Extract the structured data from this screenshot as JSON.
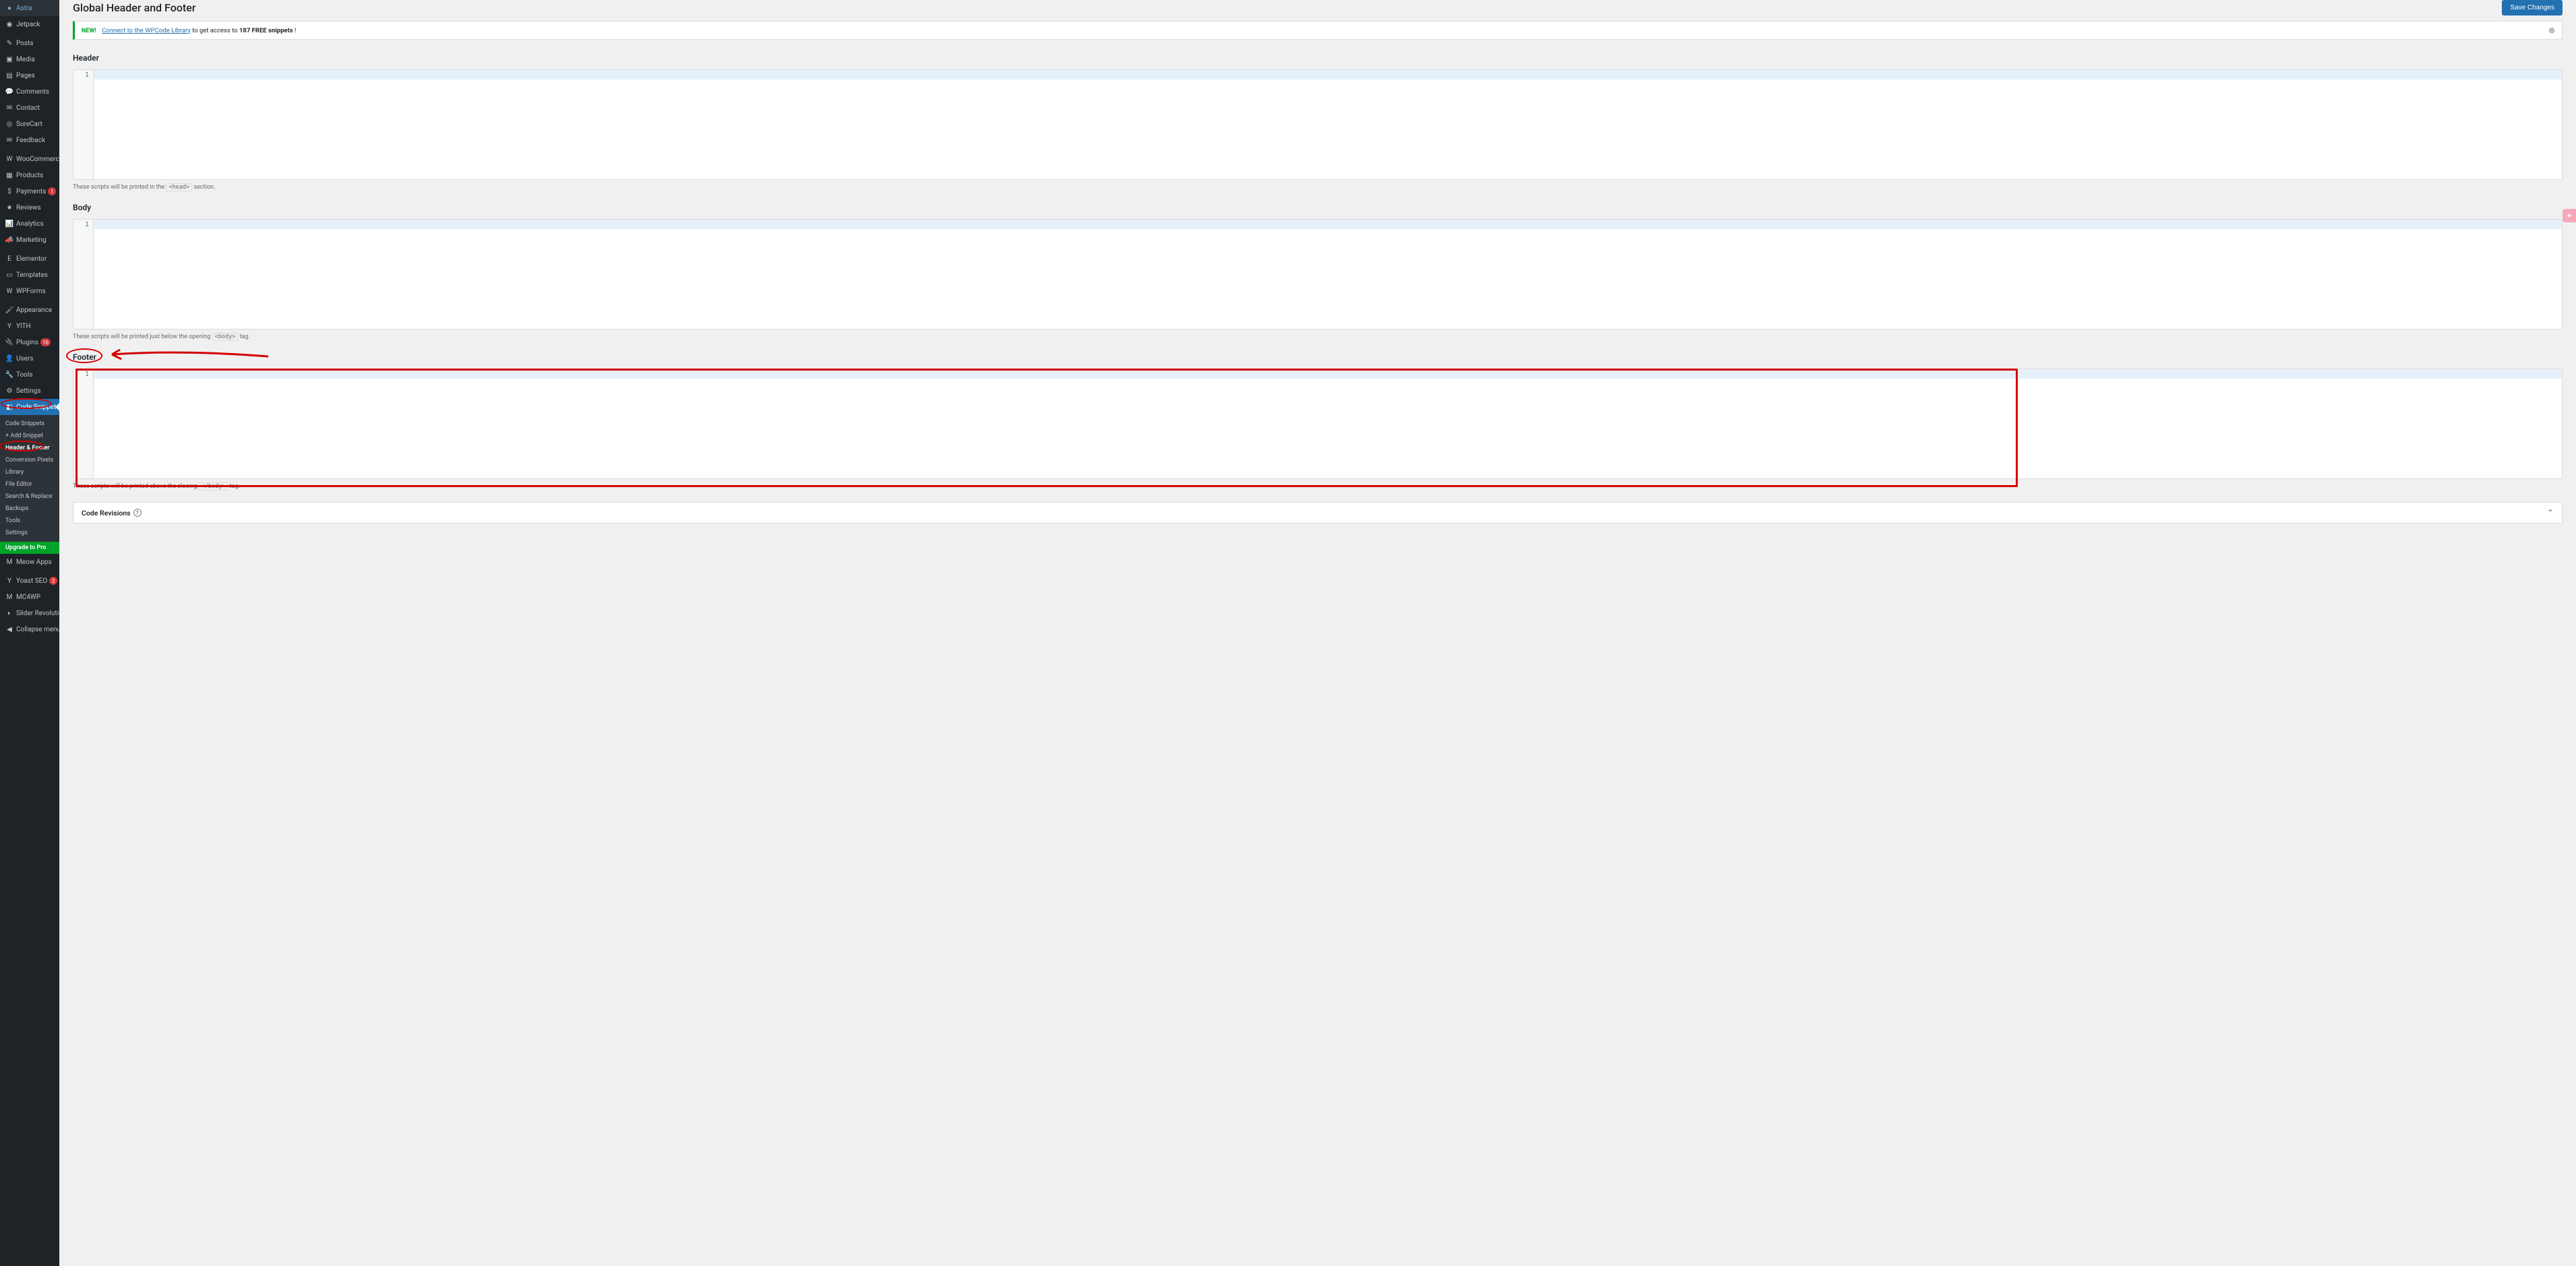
{
  "page": {
    "title": "Global Header and Footer",
    "save_button": "Save Changes"
  },
  "notice": {
    "new_label": "NEW!",
    "link_text": "Connect to the WPCode Library",
    "mid_text": " to get access to ",
    "bold_text": "187 FREE snippets",
    "end_text": "!"
  },
  "sections": {
    "header": {
      "label": "Header",
      "line_no": "1",
      "helper_pre": "These scripts will be printed in the ",
      "helper_tag": "<head>",
      "helper_post": " section."
    },
    "body": {
      "label": "Body",
      "line_no": "1",
      "helper_pre": "These scripts will be printed just below the opening ",
      "helper_tag": "<body>",
      "helper_post": " tag."
    },
    "footer": {
      "label": "Footer",
      "line_no": "1",
      "helper_pre": "These scripts will be printed above the closing ",
      "helper_tag": "</body>",
      "helper_post": " tag."
    }
  },
  "revisions": {
    "title": "Code Revisions"
  },
  "sidebar": {
    "top_items": [
      {
        "icon": "●",
        "label": "Astra"
      },
      {
        "icon": "◉",
        "label": "Jetpack"
      }
    ],
    "content_items": [
      {
        "icon": "✎",
        "label": "Posts"
      },
      {
        "icon": "▣",
        "label": "Media"
      },
      {
        "icon": "▤",
        "label": "Pages"
      },
      {
        "icon": "💬",
        "label": "Comments"
      },
      {
        "icon": "✉",
        "label": "Contact"
      },
      {
        "icon": "◎",
        "label": "SureCart"
      },
      {
        "icon": "✉",
        "label": "Feedback"
      }
    ],
    "commerce_items": [
      {
        "icon": "W",
        "label": "WooCommerce"
      },
      {
        "icon": "▦",
        "label": "Products"
      },
      {
        "icon": "$",
        "label": "Payments",
        "badge": "1"
      },
      {
        "icon": "★",
        "label": "Reviews"
      },
      {
        "icon": "📊",
        "label": "Analytics"
      },
      {
        "icon": "📣",
        "label": "Marketing"
      }
    ],
    "builder_items": [
      {
        "icon": "E",
        "label": "Elementor"
      },
      {
        "icon": "▭",
        "label": "Templates"
      },
      {
        "icon": "W",
        "label": "WPForms"
      }
    ],
    "admin_items": [
      {
        "icon": "🖌",
        "label": "Appearance"
      },
      {
        "icon": "Y",
        "label": "YITH"
      },
      {
        "icon": "🔌",
        "label": "Plugins",
        "badge": "16"
      },
      {
        "icon": "👤",
        "label": "Users"
      },
      {
        "icon": "🔧",
        "label": "Tools"
      },
      {
        "icon": "⚙",
        "label": "Settings"
      }
    ],
    "code_snippets": {
      "icon": "◧",
      "label": "Code Snippets"
    },
    "submenu": [
      {
        "label": "Code Snippets"
      },
      {
        "label": "+ Add Snippet"
      },
      {
        "label": "Header & Footer",
        "active": true
      },
      {
        "label": "Conversion Pixels"
      },
      {
        "label": "Library"
      },
      {
        "label": "File Editor"
      },
      {
        "label": "Search & Replace"
      },
      {
        "label": "Backups"
      },
      {
        "label": "Tools"
      },
      {
        "label": "Settings"
      }
    ],
    "upgrade": "Upgrade to Pro",
    "bottom_items": [
      {
        "icon": "M",
        "label": "Meow Apps"
      }
    ],
    "seo_items": [
      {
        "icon": "Y",
        "label": "Yoast SEO",
        "badge": "2"
      },
      {
        "icon": "M",
        "label": "MC4WP"
      },
      {
        "icon": "◐",
        "label": "Slider Revolution"
      }
    ],
    "collapse": {
      "icon": "◀",
      "label": "Collapse menu"
    }
  }
}
